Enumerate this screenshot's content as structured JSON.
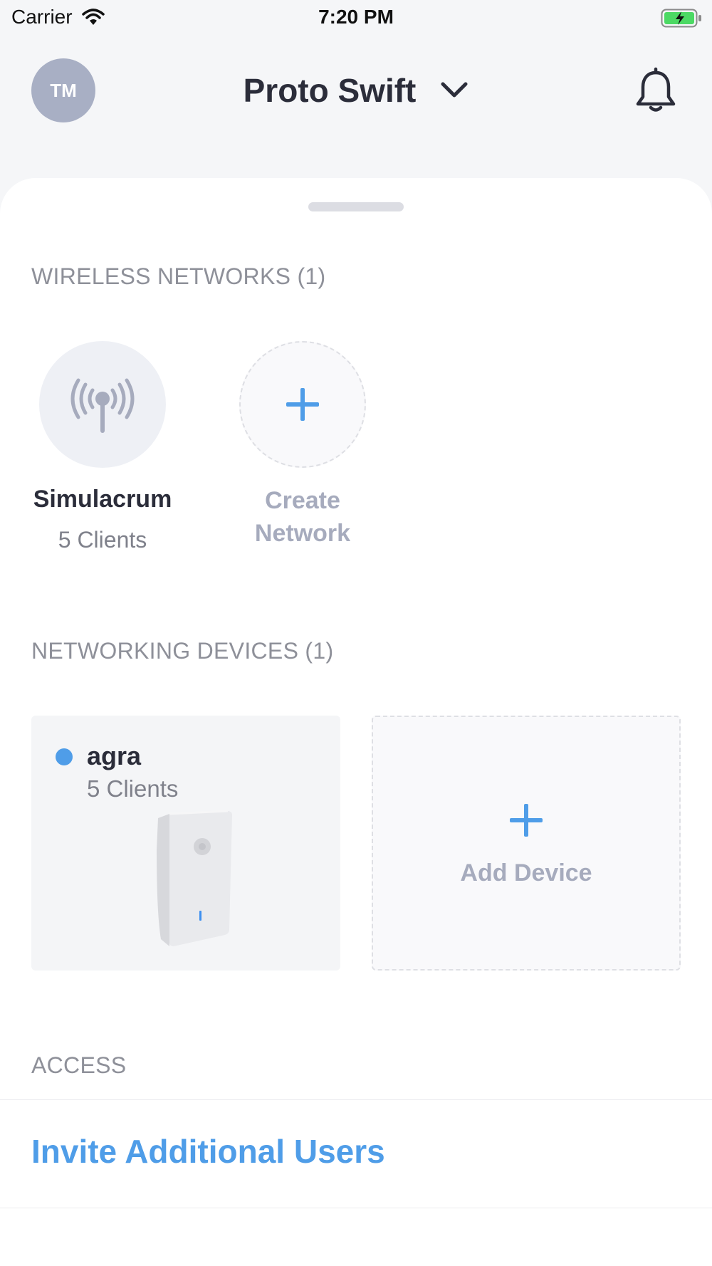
{
  "status_bar": {
    "carrier": "Carrier",
    "time": "7:20 PM",
    "battery_color": "#4cd964"
  },
  "header": {
    "avatar_initials": "TM",
    "title": "Proto Swift",
    "title_icon": "chevron-down-icon",
    "notification_icon": "bell-icon"
  },
  "wireless": {
    "header": "WIRELESS NETWORKS (1)",
    "networks": [
      {
        "name": "Simulacrum",
        "clients": "5 Clients",
        "icon": "antenna-icon"
      }
    ],
    "create": {
      "line1": "Create",
      "line2": "Network",
      "icon": "plus-icon"
    }
  },
  "devices": {
    "header": "NETWORKING DEVICES (1)",
    "items": [
      {
        "name": "agra",
        "clients": "5 Clients",
        "status_color": "#4f9de8"
      }
    ],
    "add": {
      "label": "Add Device",
      "icon": "plus-icon"
    }
  },
  "access": {
    "header": "ACCESS",
    "invite_label": "Invite Additional Users"
  },
  "colors": {
    "accent": "#4f9de8",
    "muted": "#a6abbd",
    "text": "#2b2d3a"
  }
}
